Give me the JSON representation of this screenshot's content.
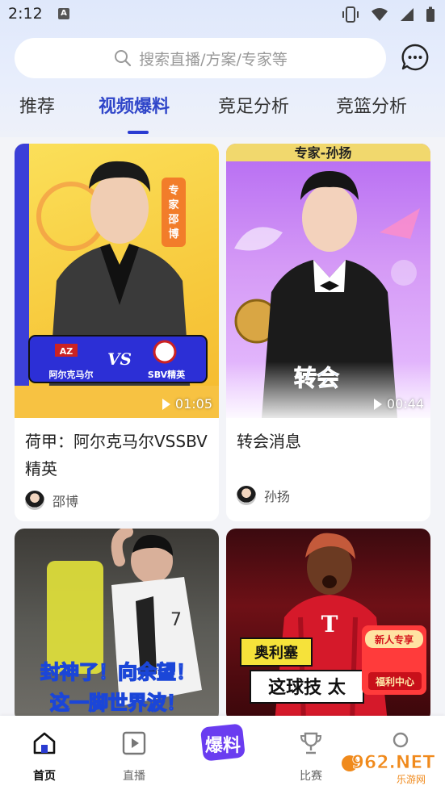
{
  "status": {
    "time": "2:12",
    "app_badge": "A"
  },
  "search": {
    "placeholder": "搜索直播/方案/专家等"
  },
  "tabs": [
    {
      "label": "推荐"
    },
    {
      "label": "视频爆料"
    },
    {
      "label": "竞足分析"
    },
    {
      "label": "竞篮分析"
    }
  ],
  "cards": [
    {
      "title": "荷甲：阿尔克马尔VSSBV精英",
      "duration": "01:05",
      "author": "邵博",
      "thumb": {
        "badge_text": "专家邵博",
        "vs": "VS",
        "team_left": "阿尔克马尔",
        "team_right": "SBV精英",
        "logo_left": "AZ"
      }
    },
    {
      "title": "转会消息",
      "duration": "00:44",
      "author": "孙扬",
      "thumb": {
        "banner": "专家-孙扬",
        "caption": "转会"
      }
    },
    {
      "thumb": {
        "caption_top": "封神了！向余望！",
        "caption_bottom": "这一脚世界波！",
        "jersey_number": "7"
      }
    },
    {
      "thumb": {
        "caption_top": "奥利塞",
        "caption_bottom": "这球技 太",
        "promo_top": "新人专享",
        "promo_bottom": "福利中心"
      }
    }
  ],
  "nav": [
    {
      "label": "首页",
      "icon": "home-icon",
      "active": true
    },
    {
      "label": "直播",
      "icon": "play-square-icon"
    },
    {
      "label": "爆料",
      "icon": "baoliao-logo-icon"
    },
    {
      "label": "比赛",
      "icon": "trophy-icon"
    },
    {
      "label": "",
      "icon": "profile-icon"
    }
  ],
  "watermark": {
    "text": "962.NET",
    "sub": "乐游网"
  },
  "colors": {
    "accent": "#2a3bd1",
    "bg": "#f3f4f8"
  }
}
